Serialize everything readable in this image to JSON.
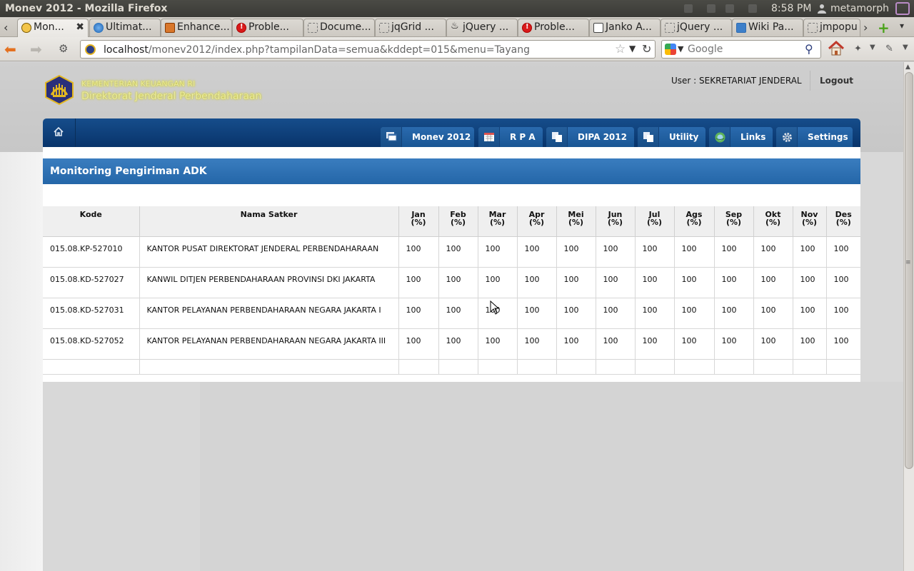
{
  "window": {
    "title": "Monev 2012 - Mozilla Firefox",
    "clock": "8:58 PM",
    "username": "metamorph"
  },
  "tabs": [
    {
      "label": "Mon...",
      "icon": "site-favicon-icon",
      "active": true
    },
    {
      "label": "Ultimat...",
      "icon": "globe-icon"
    },
    {
      "label": "Enhance...",
      "icon": "page-favicon-icon"
    },
    {
      "label": "Proble...",
      "icon": "error-icon"
    },
    {
      "label": "Docume...",
      "icon": "blank-page-icon"
    },
    {
      "label": "jqGrid ...",
      "icon": "blank-page-icon"
    },
    {
      "label": "jQuery ...",
      "icon": "flame-icon"
    },
    {
      "label": "Proble...",
      "icon": "error-icon"
    },
    {
      "label": "Janko A...",
      "icon": "chart-icon"
    },
    {
      "label": "jQuery ...",
      "icon": "blank-page-icon"
    },
    {
      "label": "Wiki Pa...",
      "icon": "wp-icon"
    },
    {
      "label": "jmpopu",
      "icon": "blank-page-icon"
    }
  ],
  "nav": {
    "url_host": "localhost",
    "url_path": "/monev2012/index.php?tampilanData=semua&kddept=015&menu=Tayang",
    "search_placeholder": "Google"
  },
  "header": {
    "brand_line1": "KEMENTERIAN KEUANGAN RI",
    "brand_line2": "Direktorat Jenderal Perbendaharaan",
    "user_label": "User : SEKRETARIAT JENDERAL",
    "logout": "Logout"
  },
  "menu": [
    {
      "label": "Monev 2012",
      "icon": "windows-icon"
    },
    {
      "label": "R P A",
      "icon": "calendar-icon"
    },
    {
      "label": "DIPA 2012",
      "icon": "copy-icon"
    },
    {
      "label": "Utility",
      "icon": "copy-icon"
    },
    {
      "label": "Links",
      "icon": "globe-icon"
    },
    {
      "label": "Settings",
      "icon": "gear-icon"
    }
  ],
  "panel": {
    "title": "Monitoring Pengiriman ADK"
  },
  "table": {
    "columns": [
      "Kode",
      "Nama Satker",
      "Jan",
      "Feb",
      "Mar",
      "Apr",
      "Mei",
      "Jun",
      "Jul",
      "Ags",
      "Sep",
      "Okt",
      "Nov",
      "Des"
    ],
    "unit": "(%)",
    "rows": [
      {
        "kode": "015.08.KP-527010",
        "nama": "KANTOR PUSAT DIREKTORAT JENDERAL PERBENDAHARAAN",
        "values": [
          "100",
          "100",
          "100",
          "100",
          "100",
          "100",
          "100",
          "100",
          "100",
          "100",
          "100",
          "100"
        ]
      },
      {
        "kode": "015.08.KD-527027",
        "nama": "KANWIL DITJEN PERBENDAHARAAN PROVINSI DKI JAKARTA",
        "values": [
          "100",
          "100",
          "100",
          "100",
          "100",
          "100",
          "100",
          "100",
          "100",
          "100",
          "100",
          "100"
        ]
      },
      {
        "kode": "015.08.KD-527031",
        "nama": "KANTOR PELAYANAN PERBENDAHARAAN NEGARA JAKARTA I",
        "values": [
          "100",
          "100",
          "100",
          "100",
          "100",
          "100",
          "100",
          "100",
          "100",
          "100",
          "100",
          "100"
        ]
      },
      {
        "kode": "015.08.KD-527052",
        "nama": "KANTOR PELAYANAN PERBENDAHARAAN NEGARA JAKARTA III",
        "values": [
          "100",
          "100",
          "100",
          "100",
          "100",
          "100",
          "100",
          "100",
          "100",
          "100",
          "100",
          "100"
        ]
      }
    ]
  }
}
